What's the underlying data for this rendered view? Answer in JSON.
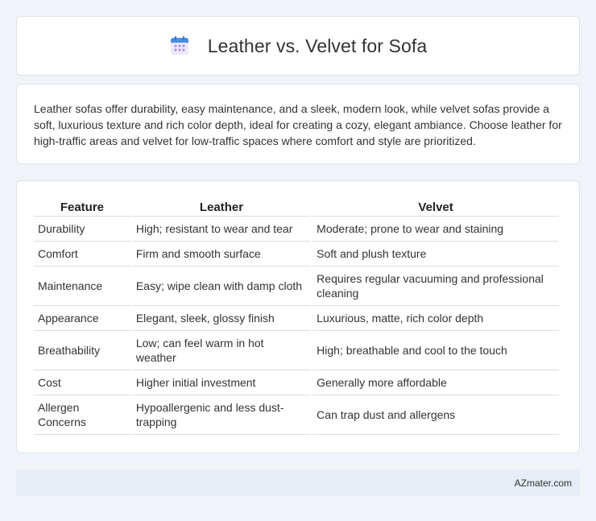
{
  "header": {
    "title": "Leather vs. Velvet for Sofa",
    "icon": "calendar-icon"
  },
  "intro": {
    "text": "Leather sofas offer durability, easy maintenance, and a sleek, modern look, while velvet sofas provide a soft, luxurious texture and rich color depth, ideal for creating a cozy, elegant ambiance. Choose leather for high-traffic areas and velvet for low-traffic spaces where comfort and style are prioritized."
  },
  "table": {
    "headers": [
      "Feature",
      "Leather",
      "Velvet"
    ],
    "rows": [
      [
        "Durability",
        "High; resistant to wear and tear",
        "Moderate; prone to wear and staining"
      ],
      [
        "Comfort",
        "Firm and smooth surface",
        "Soft and plush texture"
      ],
      [
        "Maintenance",
        "Easy; wipe clean with damp cloth",
        "Requires regular vacuuming and professional cleaning"
      ],
      [
        "Appearance",
        "Elegant, sleek, glossy finish",
        "Luxurious, matte, rich color depth"
      ],
      [
        "Breathability",
        "Low; can feel warm in hot weather",
        "High; breathable and cool to the touch"
      ],
      [
        "Cost",
        "Higher initial investment",
        "Generally more affordable"
      ],
      [
        "Allergen Concerns",
        "Hypoallergenic and less dust-trapping",
        "Can trap dust and allergens"
      ]
    ]
  },
  "footer": {
    "text": "AZmater.com"
  },
  "colors": {
    "background": "#f0f3f8",
    "card": "#ffffff",
    "footer_bg": "#e6edf7",
    "icon_blue": "#4a8de8",
    "icon_purple": "#a98ee0"
  }
}
